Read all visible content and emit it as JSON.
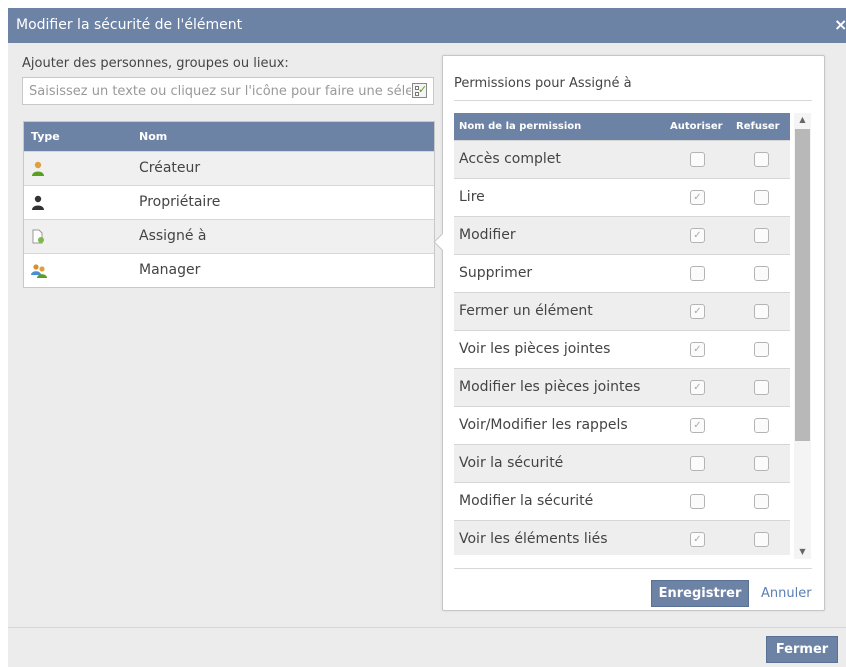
{
  "dialog": {
    "title": "Modifier la sécurité de l'élément",
    "close_symbol": "×",
    "close_button_label": "Fermer"
  },
  "add": {
    "label": "Ajouter des personnes, groupes ou lieux:",
    "placeholder": "Saisissez un texte ou cliquez sur l'icône pour faire une sélection",
    "picker_icon": "address-book-check-icon"
  },
  "types_table": {
    "headers": {
      "type": "Type",
      "name": "Nom"
    },
    "rows": [
      {
        "icon": "creator-user-icon",
        "name": "Créateur",
        "selected": false
      },
      {
        "icon": "owner-user-icon",
        "name": "Propriétaire",
        "selected": false
      },
      {
        "icon": "assignee-document-icon",
        "name": "Assigné à",
        "selected": true
      },
      {
        "icon": "manager-group-icon",
        "name": "Manager",
        "selected": false
      }
    ]
  },
  "permissions": {
    "title": "Permissions pour Assigné à",
    "headers": {
      "name": "Nom de la permission",
      "allow": "Autoriser",
      "deny": "Refuser"
    },
    "rows": [
      {
        "name": "Accès complet",
        "allow": false,
        "deny": false
      },
      {
        "name": "Lire",
        "allow": true,
        "deny": false
      },
      {
        "name": "Modifier",
        "allow": true,
        "deny": false
      },
      {
        "name": "Supprimer",
        "allow": false,
        "deny": false
      },
      {
        "name": "Fermer un élément",
        "allow": true,
        "deny": false
      },
      {
        "name": "Voir les pièces jointes",
        "allow": true,
        "deny": false
      },
      {
        "name": "Modifier les pièces jointes",
        "allow": true,
        "deny": false
      },
      {
        "name": "Voir/Modifier les rappels",
        "allow": true,
        "deny": false
      },
      {
        "name": "Voir la sécurité",
        "allow": false,
        "deny": false
      },
      {
        "name": "Modifier la sécurité",
        "allow": false,
        "deny": false
      },
      {
        "name": "Voir les éléments liés",
        "allow": true,
        "deny": false
      }
    ],
    "check_mark": "✓",
    "save_label": "Enregistrer",
    "cancel_label": "Annuler"
  },
  "colors": {
    "header_blue": "#6c83a6",
    "link_blue": "#5a7fb5",
    "dialog_bg": "#ececec"
  }
}
